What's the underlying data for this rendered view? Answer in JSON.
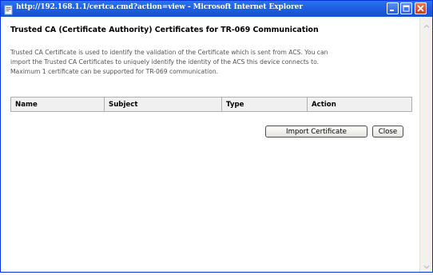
{
  "window": {
    "title": "http://192.168.1.1/certca.cmd?action=view - Microsoft Internet Explorer",
    "accent_color": "#1f5fe0",
    "close_color": "#c8401e"
  },
  "page": {
    "title": "Trusted CA (Certificate Authority) Certificates for TR-069 Communication",
    "description_lines": [
      "Trusted CA Certificate is used to identify the validation of the Certificate which is sent from ACS. You can",
      "import the Trusted CA Certificates to uniquely identify the identity of the ACS this device connects to.",
      "Maximum 1 certificate can be supported for TR-069 communication."
    ]
  },
  "table": {
    "columns": [
      "Name",
      "Subject",
      "Type",
      "Action"
    ]
  },
  "buttons": {
    "import_label": "Import Certificate",
    "close_label": "Close"
  },
  "icons": {
    "title_icon": "ie-page-icon",
    "minimize": "minimize-icon",
    "maximize": "maximize-icon",
    "close": "close-icon",
    "scroll_up": "scroll-up-arrow-icon",
    "scroll_down": "scroll-down-arrow-icon"
  }
}
